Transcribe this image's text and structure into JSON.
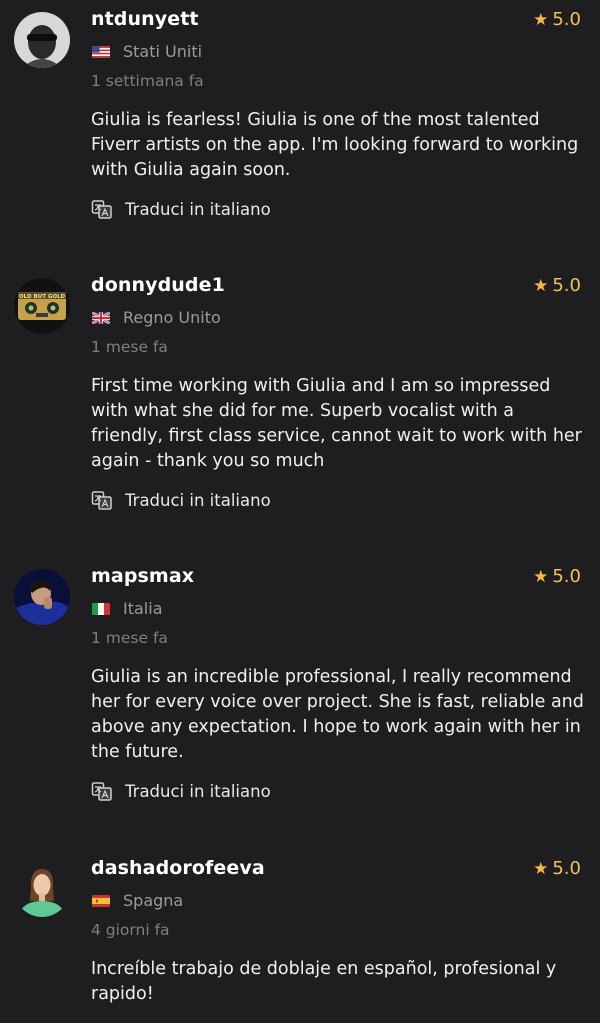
{
  "reviews": [
    {
      "username": "ntdunyett",
      "rating": "5.0",
      "country": "Stati Uniti",
      "flag": "us-flag",
      "time": "1 settimana fa",
      "text": "Giulia is fearless! Giulia is one of the most talented Fiverr artists on the app. I'm looking forward to working with Giulia again soon.",
      "translate_label": "Traduci in italiano"
    },
    {
      "username": "donnydude1",
      "rating": "5.0",
      "country": "Regno Unito",
      "flag": "uk-flag",
      "time": "1 mese fa",
      "text": "First time working with Giulia and I am so impressed with what she did for me. Superb vocalist with a friendly, first class service, cannot wait to work with her again - thank you so much",
      "translate_label": "Traduci in italiano",
      "avatar_text": "OLD BUT GOLD"
    },
    {
      "username": "mapsmax",
      "rating": "5.0",
      "country": "Italia",
      "flag": "italy-flag",
      "time": "1 mese fa",
      "text": "Giulia is an incredible professional, I really recommend her for every voice over project. She is fast, reliable and above any expectation. I hope to work again with her in the future.",
      "translate_label": "Traduci in italiano"
    },
    {
      "username": "dashadorofeeva",
      "rating": "5.0",
      "country": "Spagna",
      "flag": "spain-flag",
      "time": "4 giorni fa",
      "text": "Increíble trabajo de doblaje en español, profesional y rapido!"
    }
  ],
  "colors": {
    "background": "#1e1e20",
    "star": "#f2b84b",
    "muted": "#9a9a9f"
  }
}
